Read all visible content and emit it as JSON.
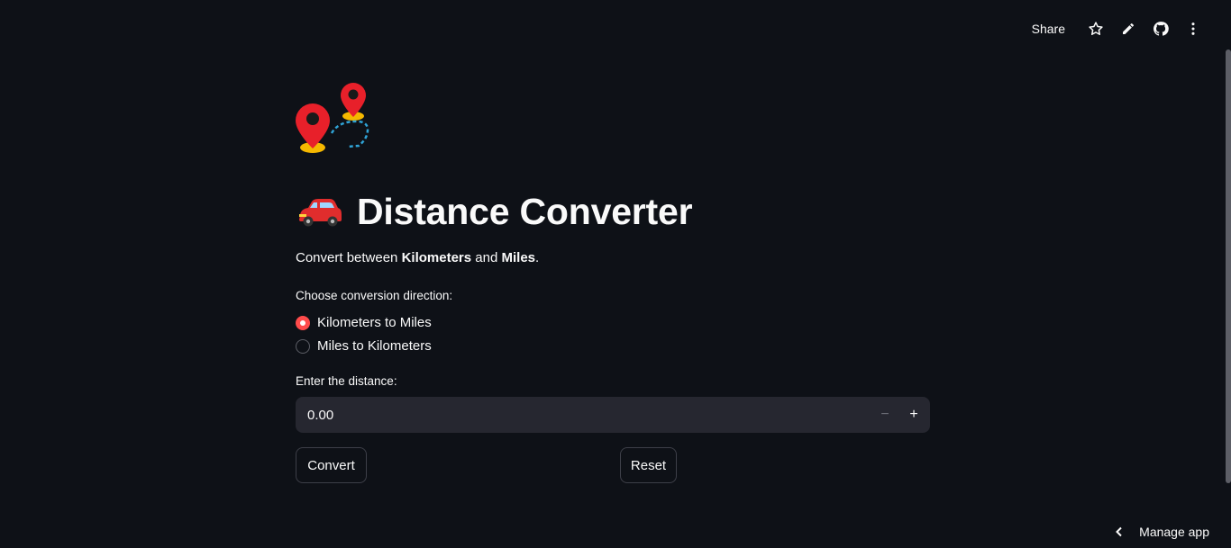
{
  "toolbar": {
    "share_label": "Share",
    "icons": [
      "star-icon",
      "pencil-icon",
      "github-icon",
      "more-vertical-icon"
    ]
  },
  "header": {
    "logo_icon": "map-pins-route-icon",
    "title_icon": "car-icon",
    "title": "Distance Converter"
  },
  "intro": {
    "prefix": "Convert between ",
    "bold1": "Kilometers",
    "middle": " and ",
    "bold2": "Miles",
    "suffix": "."
  },
  "direction": {
    "label": "Choose conversion direction:",
    "options": [
      {
        "label": "Kilometers to Miles",
        "selected": true
      },
      {
        "label": "Miles to Kilometers",
        "selected": false
      }
    ]
  },
  "distance": {
    "label": "Enter the distance:",
    "value": "0.00",
    "minus_symbol": "−",
    "plus_symbol": "+"
  },
  "buttons": {
    "convert_label": "Convert",
    "reset_label": "Reset"
  },
  "footer": {
    "manage_label": "Manage app"
  },
  "colors": {
    "background": "#0e1117",
    "accent": "#ff4b4b",
    "input_bg": "#262730",
    "text": "#fafafa"
  }
}
